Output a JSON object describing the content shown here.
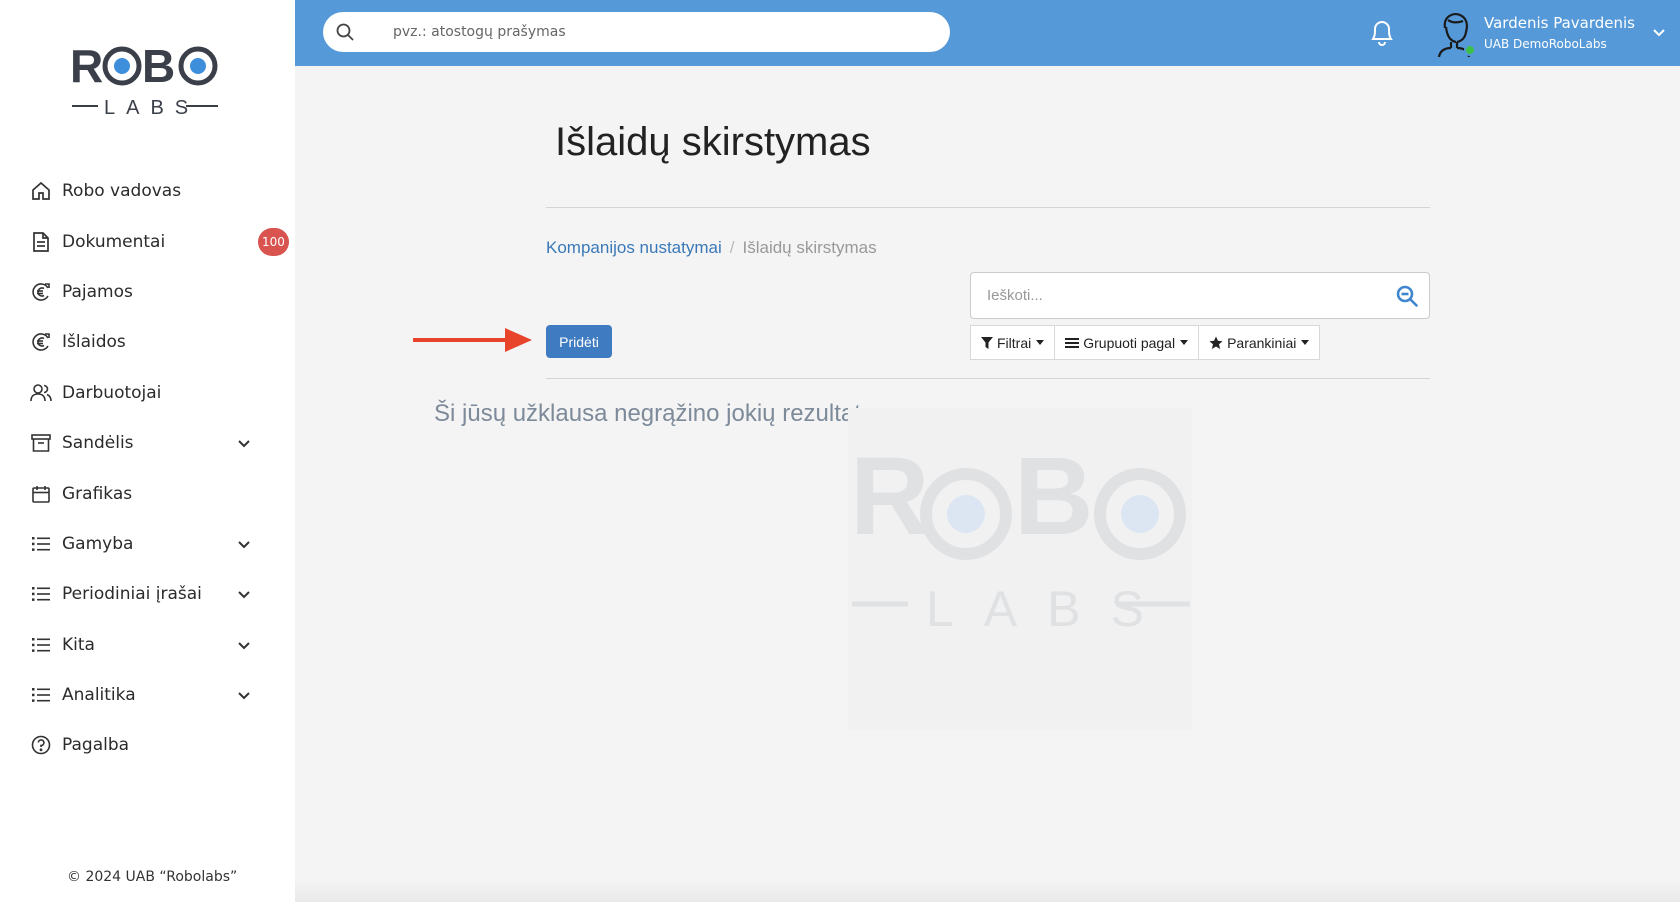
{
  "brand": {
    "logo_text_top": "ROBO",
    "logo_text_bottom": "LABS",
    "accent_color": "#5599d8",
    "logo_blue": "#3d8fdb"
  },
  "sidebar": {
    "items": [
      {
        "label": "Robo vadovas",
        "icon": "home-icon"
      },
      {
        "label": "Dokumentai",
        "icon": "document-icon",
        "badge": "100"
      },
      {
        "label": "Pajamos",
        "icon": "euro-circle-icon"
      },
      {
        "label": "Išlaidos",
        "icon": "euro-circle-icon"
      },
      {
        "label": "Darbuotojai",
        "icon": "users-icon"
      },
      {
        "label": "Sandėlis",
        "icon": "archive-icon",
        "expandable": true
      },
      {
        "label": "Grafikas",
        "icon": "calendar-icon"
      },
      {
        "label": "Gamyba",
        "icon": "list-icon",
        "expandable": true
      },
      {
        "label": "Periodiniai įrašai",
        "icon": "list-icon",
        "expandable": true
      },
      {
        "label": "Kita",
        "icon": "list-icon",
        "expandable": true
      },
      {
        "label": "Analitika",
        "icon": "list-icon",
        "expandable": true
      },
      {
        "label": "Pagalba",
        "icon": "help-icon"
      }
    ],
    "copyright": "© 2024 UAB “Robolabs”"
  },
  "topbar": {
    "search_placeholder": "pvz.: atostogų prašymas",
    "user_name": "Vardenis Pavardenis",
    "user_company": "UAB DemoRoboLabs"
  },
  "main": {
    "title": "Išlaidų skirstymas",
    "breadcrumb": {
      "parent": "Kompanijos nustatymai",
      "separator": "/",
      "current": "Išlaidų skirstymas"
    },
    "search_placeholder": "Ieškoti...",
    "add_button": "Pridėti",
    "filters_label": "Filtrai",
    "group_by_label": "Grupuoti pagal",
    "favorites_label": "Parankiniai",
    "no_results": "Ši jūsų užklausa negrąžino jokių rezultatų"
  }
}
